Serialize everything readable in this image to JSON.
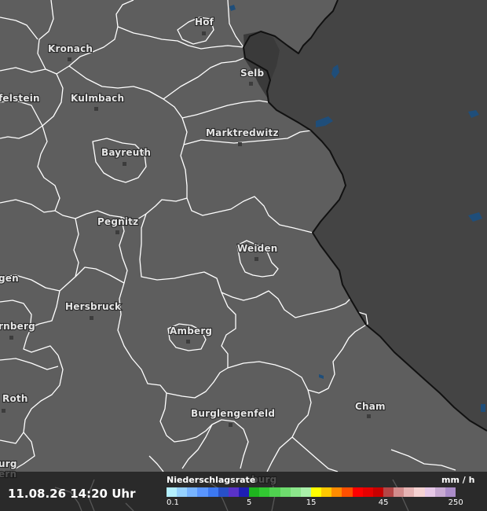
{
  "cities": [
    {
      "name": "Hof"
    },
    {
      "name": "Kronach"
    },
    {
      "name": "Selb"
    },
    {
      "name": "felstein"
    },
    {
      "name": "Kulmbach"
    },
    {
      "name": "Marktredwitz"
    },
    {
      "name": "Bayreuth"
    },
    {
      "name": "Pegnitz"
    },
    {
      "name": "Weiden"
    },
    {
      "name": "gen"
    },
    {
      "name": "Hersbruck"
    },
    {
      "name": "rnberg"
    },
    {
      "name": "Amberg"
    },
    {
      "name": "Roth"
    },
    {
      "name": "Cham"
    },
    {
      "name": "Burglengenfeld"
    },
    {
      "name": "burg"
    },
    {
      "name": "ern"
    },
    {
      "name": "urg"
    }
  ],
  "timestamp": "11.08.26 14:20 Uhr",
  "legend": {
    "title": "Niederschlagsrate",
    "unit": "mm / h",
    "colors": [
      "#b4f0ff",
      "#96d2ff",
      "#78b4ff",
      "#5a96ff",
      "#3c78f0",
      "#2850c8",
      "#5a32c8",
      "#1e1eb4",
      "#1eb41e",
      "#32c832",
      "#50d250",
      "#6edc6e",
      "#8ce68c",
      "#aaf0aa",
      "#ffff00",
      "#ffc800",
      "#ff8c00",
      "#ff5000",
      "#ff0000",
      "#e60000",
      "#c80000",
      "#b44646",
      "#d28c8c",
      "#e6b4b4",
      "#f5d2d2",
      "#e6c8e6",
      "#c8aad2",
      "#aa8cc8"
    ],
    "ticks": [
      "0.1",
      "5",
      "15",
      "45",
      "250"
    ],
    "tick_positions": [
      0,
      8,
      14,
      21,
      28
    ]
  },
  "colors": {
    "land": "#5e5e5e",
    "cz_land": "#444444",
    "border": "#ffffff",
    "national_border": "#111111",
    "water": "#1f4e7a"
  }
}
